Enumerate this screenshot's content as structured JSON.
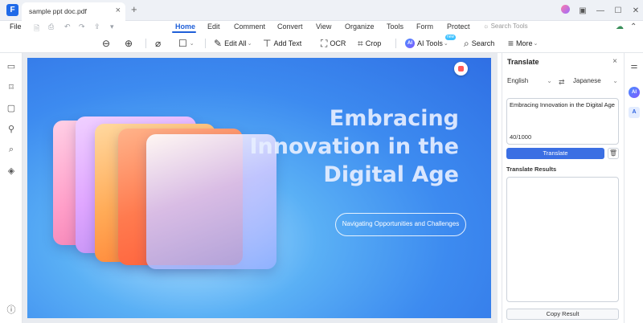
{
  "titlebar": {
    "app_logo": "F",
    "tab_label": "sample ppt doc.pdf",
    "tab_close": "×",
    "new_tab": "+",
    "controls": [
      "▣",
      "—",
      "☐",
      "✕"
    ]
  },
  "menu": {
    "file": "File",
    "quick_access": [
      "🗎",
      "⎙",
      "↶",
      "↷",
      "⇪",
      "▾"
    ],
    "tabs": [
      "Home",
      "Edit",
      "Comment",
      "Convert",
      "View",
      "Organize",
      "Tools",
      "Form",
      "Protect"
    ],
    "active_tab": "Home",
    "search_tools": "Search Tools"
  },
  "toolbar": {
    "zoom_out_icon": "zoom-out-icon",
    "zoom_in_icon": "zoom-in-icon",
    "edit_all": "Edit All",
    "add_text": "Add Text",
    "ocr": "OCR",
    "crop": "Crop",
    "ai_tools": "AI Tools",
    "ai_new_badge": "new",
    "search": "Search",
    "more": "More"
  },
  "slide": {
    "title_lines": [
      "Embracing",
      "Innovation in the",
      "Digital Age"
    ],
    "subtitle": "Navigating Opportunities and Challenges"
  },
  "translate_panel": {
    "title": "Translate",
    "close": "×",
    "source_lang": "English",
    "target_lang": "Japanese",
    "swap": "⇄",
    "source_text": "Embracing Innovation in the Digital Age",
    "char_count": "40/1000",
    "translate_button": "Translate",
    "trash": "🗑",
    "results_label": "Translate Results",
    "copy_button": "Copy Result"
  },
  "left_sidebar_icons": [
    "page-icon",
    "bookmark-icon",
    "comment-icon",
    "attachment-icon",
    "search-icon",
    "layers-icon",
    "help-icon"
  ],
  "right_strip": {
    "ai_label": "AI",
    "translate_label": "A",
    "settings_icon": "sliders-icon"
  },
  "colors": {
    "accent": "#1f5fd8",
    "translate_button": "#3b6fe3"
  }
}
